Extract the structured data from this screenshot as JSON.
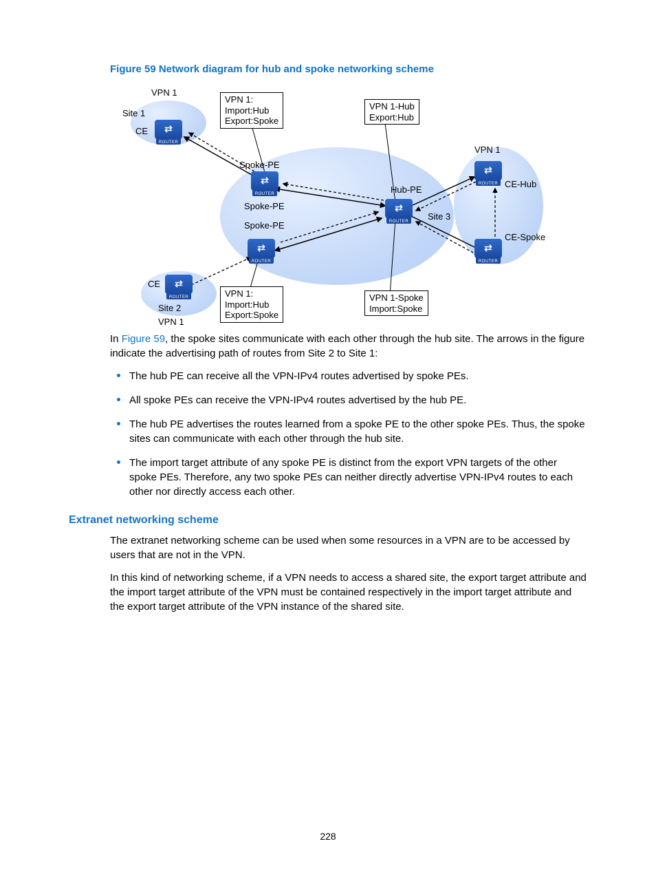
{
  "caption": "Figure 59 Network diagram for hub and spoke networking scheme",
  "diagram": {
    "labels": {
      "vpn1_a": "VPN 1",
      "site1": "Site 1",
      "ce_a": "CE",
      "spoke_pe_a": "Spoke-PE",
      "spoke_pe_b": "Spoke-PE",
      "spoke_pe_c": "Spoke-PE",
      "hub_pe": "Hub-PE",
      "vpn1_b": "VPN 1",
      "ce_hub": "CE-Hub",
      "site3": "Site 3",
      "ce_spoke": "CE-Spoke",
      "site2": "Site 2",
      "ce_b": "CE",
      "vpn1_c": "VPN 1"
    },
    "boxes": {
      "top_left": "VPN 1:\nImport:Hub\nExport:Spoke",
      "top_right": "VPN 1-Hub\nExport:Hub",
      "bottom_left": "VPN 1:\nImport:Hub\nExport:Spoke",
      "bottom_right": "VPN 1-Spoke\nImport:Spoke"
    },
    "router_label": "ROUTER"
  },
  "intro_prefix": "In ",
  "intro_ref": "Figure 59",
  "intro_suffix": ", the spoke sites communicate with each other through the hub site. The arrows in the figure indicate the advertising path of routes from Site 2 to Site 1:",
  "bullets": [
    "The hub PE can receive all the VPN-IPv4 routes advertised by spoke PEs.",
    "All spoke PEs can receive the VPN-IPv4 routes advertised by the hub PE.",
    "The hub PE advertises the routes learned from a spoke PE to the other spoke PEs. Thus, the spoke sites can communicate with each other through the hub site.",
    "The import target attribute of any spoke PE is distinct from the export VPN targets of the other spoke PEs. Therefore, any two spoke PEs can neither directly advertise VPN-IPv4 routes to each other nor directly access each other."
  ],
  "subhead": "Extranet networking scheme",
  "para1": "The extranet networking scheme can be used when some resources in a VPN are to be accessed by users that are not in the VPN.",
  "para2": "In this kind of networking scheme, if a VPN needs to access a shared site, the export target attribute and the import target attribute of the VPN must be contained respectively in the import target attribute and the export target attribute of the VPN instance of the shared site.",
  "page_num": "228"
}
